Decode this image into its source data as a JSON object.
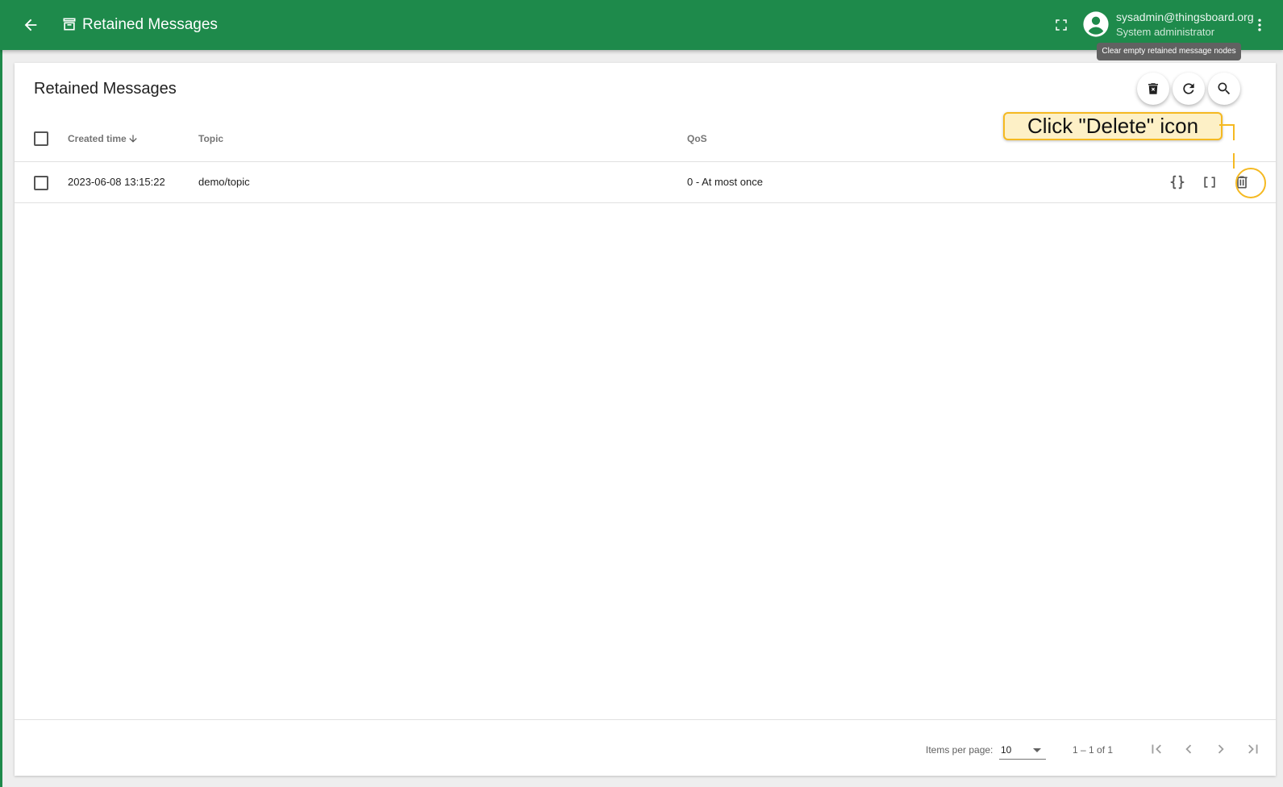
{
  "header": {
    "title": "Retained Messages",
    "user_email": "sysadmin@thingsboard.org",
    "user_role": "System administrator",
    "icons": [
      "arrow-left-icon",
      "archive-icon",
      "fullscreen-icon",
      "account-circle-icon",
      "more-vert-icon"
    ]
  },
  "tooltip": {
    "text": "Clear empty retained message nodes"
  },
  "card": {
    "title": "Retained Messages",
    "actions": [
      "delete-sweep-icon",
      "refresh-icon",
      "search-icon"
    ]
  },
  "table": {
    "columns": [
      "Created time",
      "Topic",
      "QoS"
    ],
    "sort": {
      "column": "Created time",
      "direction": "desc"
    },
    "rows": [
      {
        "created_time": "2023-06-08 13:15:22",
        "topic": "demo/topic",
        "qos": "0 - At most once"
      }
    ],
    "row_actions": [
      "code-braces-icon",
      "code-brackets-icon",
      "delete-icon"
    ]
  },
  "callout": {
    "text": "Click \"Delete\" icon"
  },
  "footer": {
    "items_per_page_label": "Items per page:",
    "items_per_page_value": "10",
    "range_label": "1 – 1 of 1"
  },
  "colors": {
    "primary": "#1e8a4b",
    "callout_fill": "#fdf0c6",
    "callout_border": "#f5b921",
    "tooltip_bg": "#616161"
  }
}
